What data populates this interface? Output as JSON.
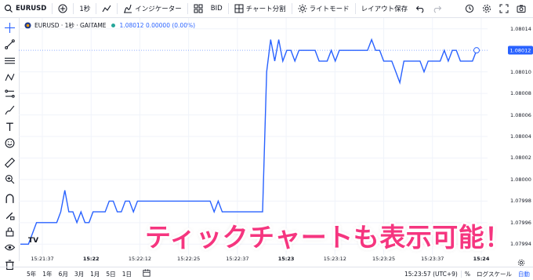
{
  "toolbar": {
    "symbol": "EURUSD",
    "interval": "1秒",
    "indicators_label": "インジケーター",
    "bid_label": "BID",
    "split_label": "チャート分割",
    "theme_label": "ライトモード",
    "save_layout_label": "レイアウト保存"
  },
  "legend": {
    "symbol_title": "EURUSD · 1秒 · GAITAME",
    "values": "1.08012  0.00000 (0.00%)"
  },
  "price_axis": {
    "labels": [
      "1.08014",
      "1.08010",
      "1.08008",
      "1.08006",
      "1.08004",
      "1.08002",
      "1.08000",
      "1.07998",
      "1.07996",
      "1.07994"
    ],
    "current_price": "1.08012"
  },
  "time_axis": {
    "labels": [
      "15:21:37",
      "15:22",
      "15:22:12",
      "15:22:25",
      "15:22:37",
      "15:23",
      "15:23:12",
      "15:23:25",
      "15:23:37",
      "15:24"
    ]
  },
  "bottom_bar": {
    "ranges": [
      "5年",
      "1年",
      "6月",
      "3月",
      "1月",
      "5日",
      "1日"
    ],
    "clock": "15:23:57 (UTC+9)",
    "percent_label": "%",
    "log_scale_label": "ログスケール",
    "auto_label": "自動"
  },
  "caption": "ティックチャートも表示可能！",
  "logo_text": "TV",
  "colors": {
    "line": "#2962ff",
    "caption": "#f5357f",
    "accent": "#2962ff"
  },
  "chart_data": {
    "type": "line",
    "y_axis_range": [
      1.07993,
      1.08015
    ],
    "series": [
      {
        "values": [
          1.07994,
          1.07994,
          1.07994,
          1.07995,
          1.07996,
          1.07996,
          1.07996,
          1.07996,
          1.07996,
          1.07996,
          1.07997,
          1.07999,
          1.07997,
          1.07997,
          1.07996,
          1.07997,
          1.07996,
          1.07996,
          1.07997,
          1.07997,
          1.07997,
          1.07997,
          1.07998,
          1.07998,
          1.07997,
          1.07997,
          1.07998,
          1.07998,
          1.07997,
          1.07998,
          1.07998,
          1.07998,
          1.07998,
          1.07998,
          1.07998,
          1.07998,
          1.07998,
          1.07998,
          1.07998,
          1.07998,
          1.07998,
          1.07998,
          1.07998,
          1.07998,
          1.07998,
          1.07998,
          1.07998,
          1.07998,
          1.07997,
          1.07998,
          1.07997,
          1.07997,
          1.07997,
          1.07997,
          1.07997,
          1.07997,
          1.07997,
          1.07997,
          1.07997,
          1.07997,
          1.07997,
          1.0801,
          1.08013,
          1.08011,
          1.08013,
          1.08011,
          1.08012,
          1.08012,
          1.08011,
          1.08012,
          1.08012,
          1.08012,
          1.08012,
          1.08012,
          1.08011,
          1.08011,
          1.08011,
          1.08012,
          1.08011,
          1.08012,
          1.08012,
          1.08012,
          1.08012,
          1.08012,
          1.08012,
          1.08012,
          1.08012,
          1.08013,
          1.08012,
          1.08012,
          1.08011,
          1.08011,
          1.08011,
          1.0801,
          1.08009,
          1.08011,
          1.08011,
          1.08011,
          1.08011,
          1.08011,
          1.0801,
          1.08011,
          1.08011,
          1.08011,
          1.08011,
          1.08012,
          1.08011,
          1.08012,
          1.08012,
          1.08011,
          1.08011,
          1.08011,
          1.08011,
          1.08012
        ]
      }
    ]
  }
}
